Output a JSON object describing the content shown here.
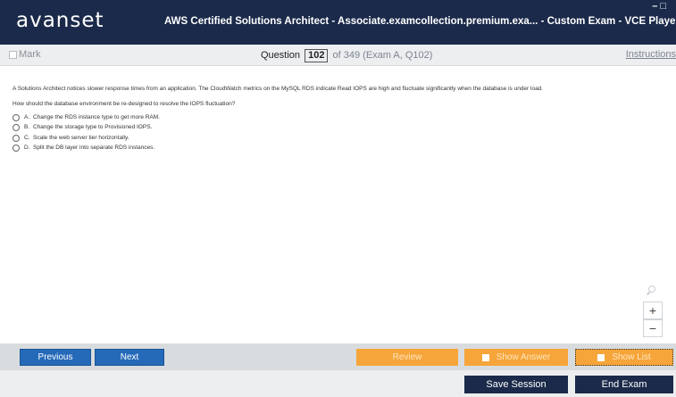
{
  "titlebar": {
    "logo": "avanset",
    "window_title": "AWS Certified Solutions Architect - Associate.examcollection.premium.exa... - Custom Exam - VCE Player",
    "controls": "–□"
  },
  "question_bar": {
    "mark_label": "Mark",
    "question_label": "Question",
    "question_number": "102",
    "of_text": "of 349 (Exam A, Q102)",
    "instructions_label": "Instructions"
  },
  "question": {
    "stem": "A Solutions Architect notices slower response times from an application. The CloudWatch metrics on the MySQL RDS indicate Read IOPS are high and fluctuate significantly when the database is under load.",
    "prompt": "How should the database environment be re-designed to resolve the IOPS fluctuation?",
    "options": [
      {
        "letter": "A.",
        "text": "Change the RDS instance type to get more RAM."
      },
      {
        "letter": "B.",
        "text": "Change the storage type to Provisioned IOPS."
      },
      {
        "letter": "C.",
        "text": "Scale the web server tier horizontally."
      },
      {
        "letter": "D.",
        "text": "Split the DB layer into separate RDS instances."
      }
    ]
  },
  "zoom": {
    "plus": "+",
    "minus": "−"
  },
  "nav": {
    "previous_label": "Previous",
    "next_label": "Next",
    "review_label": "Review",
    "show_answer_label": "Show Answer",
    "show_list_label": "Show List",
    "blue_color": "#2569b9",
    "orange_color": "#f6a53a"
  },
  "actions": {
    "save_session_label": "Save Session",
    "end_exam_label": "End Exam",
    "dark_color": "#1b2a4a"
  }
}
